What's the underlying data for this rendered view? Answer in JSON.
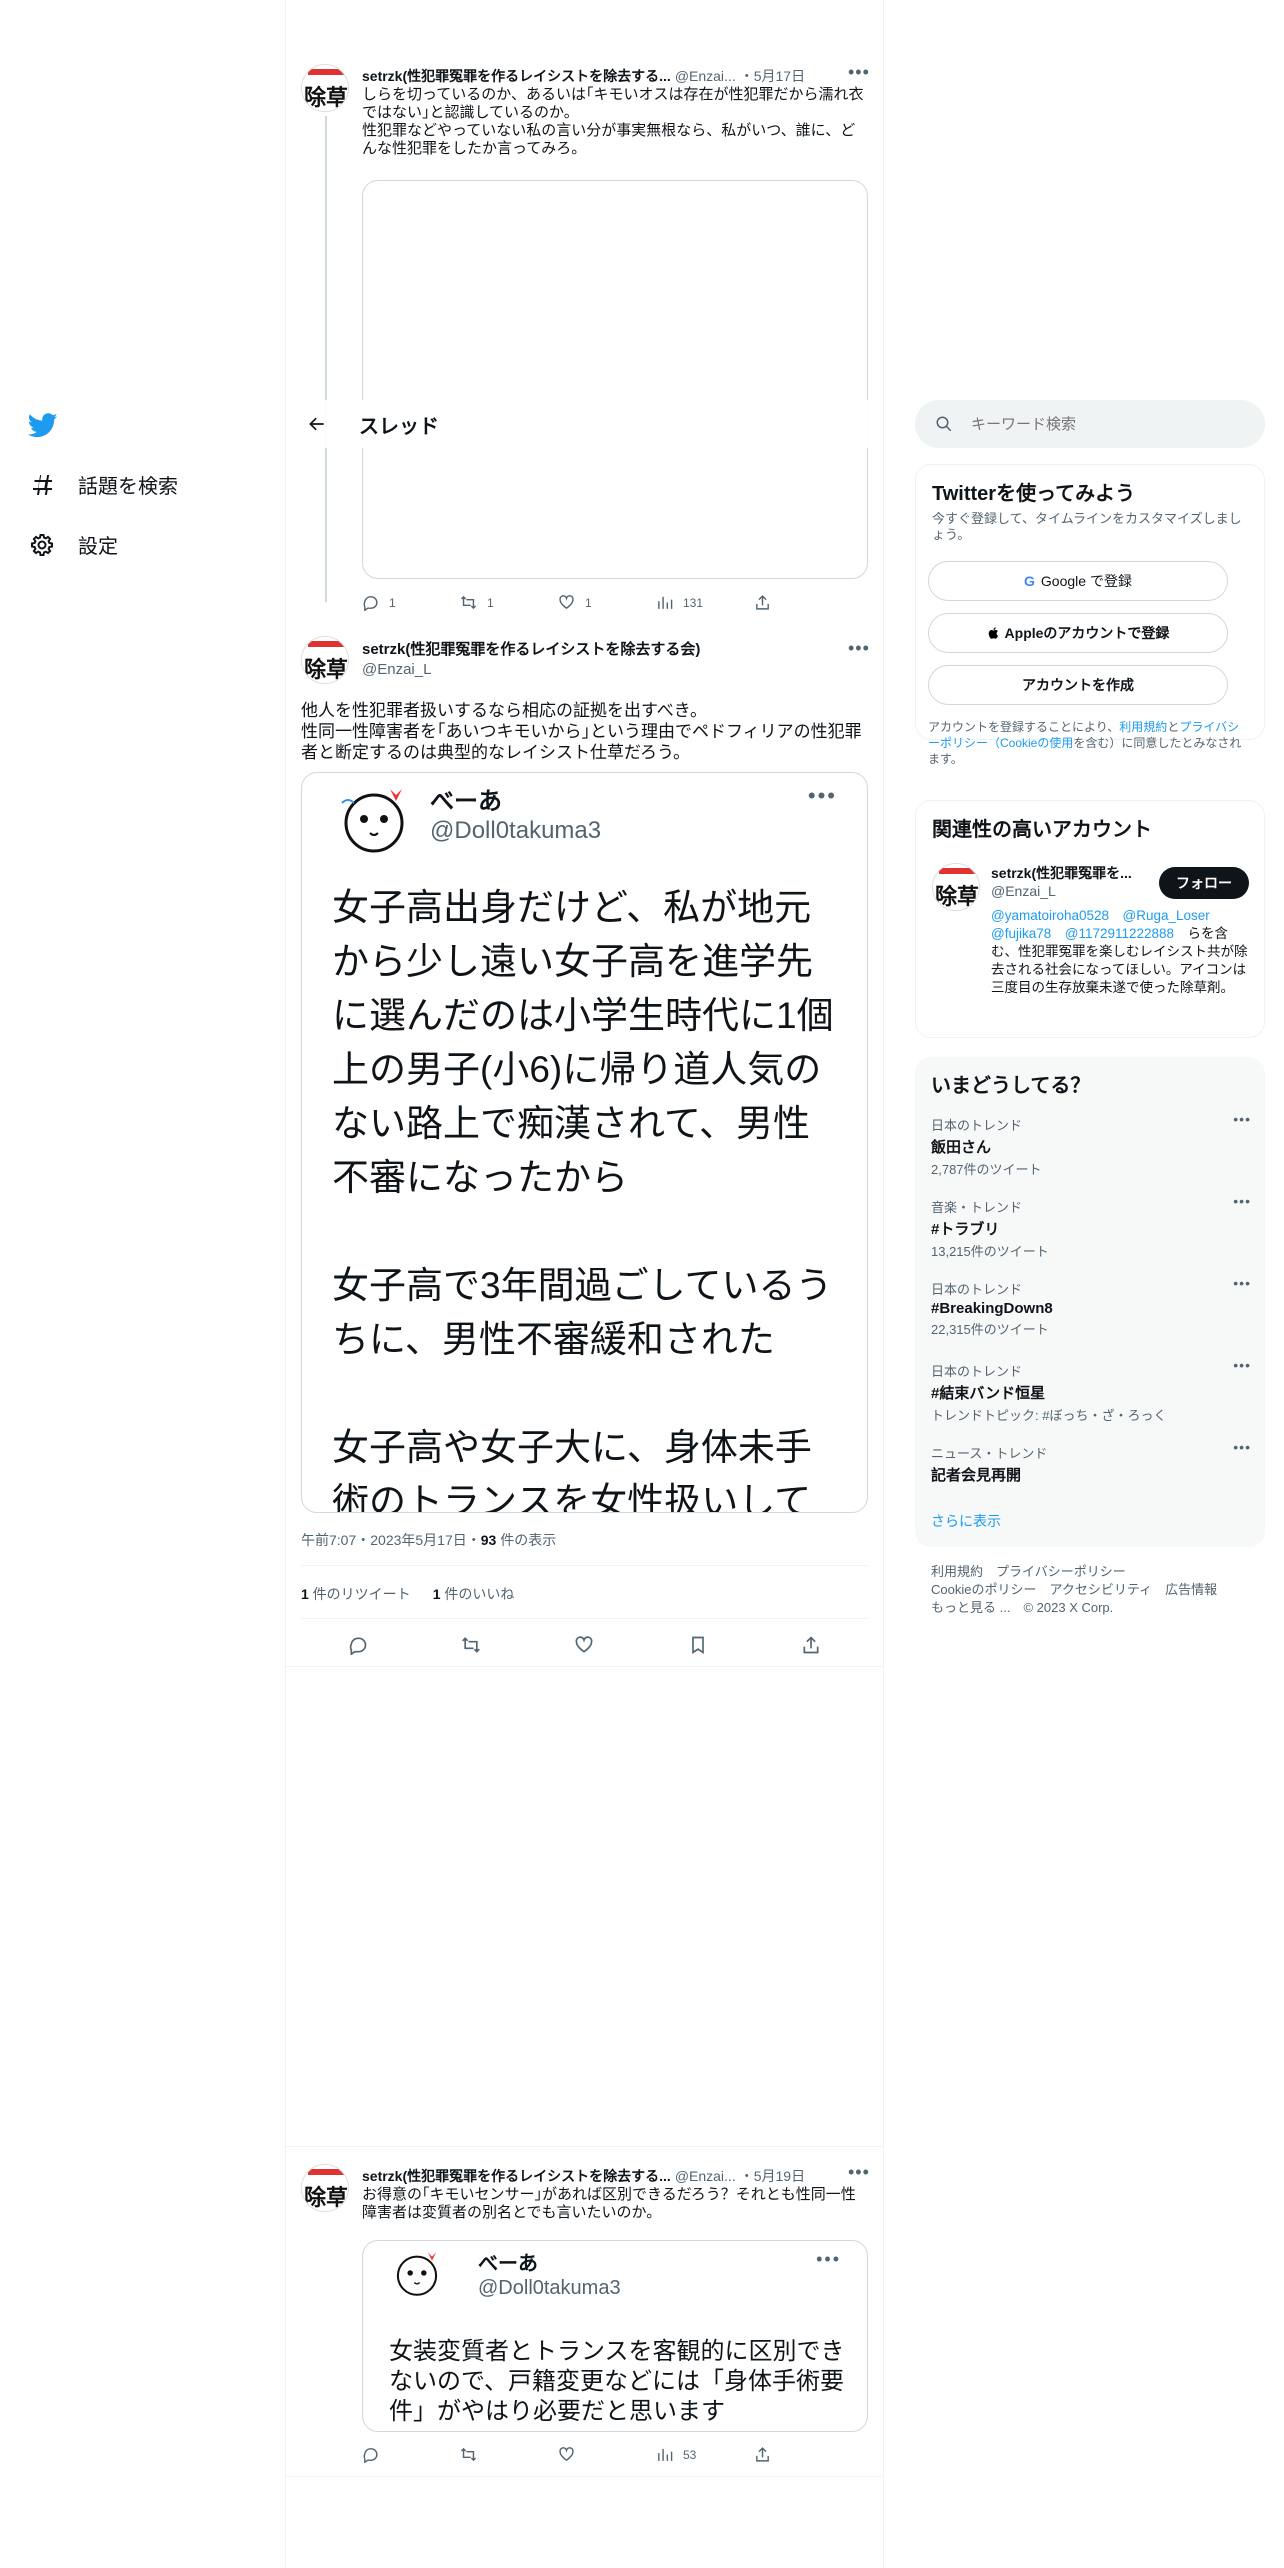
{
  "colors": {
    "brand": "#1d9bf0",
    "text": "#0f1419",
    "secondary": "#536471",
    "border": "#eff3f4"
  },
  "nav": {
    "logo": "twitter-bird-icon",
    "explore_label": "話題を検索",
    "settings_label": "設定"
  },
  "header": {
    "title": "スレッド"
  },
  "tweet1": {
    "name": "setrzk(性犯罪冤罪を作るレイシストを除去する...",
    "handle": "@Enzai...",
    "date": "・5月17日",
    "text": "しらを切っているのか、あるいは｢キモいオスは存在が性犯罪だから濡れ衣ではない｣と認識しているのか。\n性犯罪などやっていない私の言い分が事実無根なら、私がいつ、誰に、どんな性犯罪をしたか言ってみろ。",
    "replies": "1",
    "retweets": "1",
    "likes": "1",
    "views": "131"
  },
  "main_tweet": {
    "name": "setrzk(性犯罪冤罪を作るレイシストを除去する会)",
    "handle": "@Enzai_L",
    "text": "他人を性犯罪者扱いするなら相応の証拠を出すべき。\n性同一性障害者を｢あいつキモいから｣という理由でペドフィリアの性犯罪者と断定するのは典型的なレイシスト仕草だろう。",
    "quoted": {
      "name": "べーあ",
      "handle": "@Doll0takuma3",
      "text": "女子高出身だけど、私が地元から少し遠い女子高を進学先に選んだのは小学生時代に1個上の男子(小6)に帰り道人気のない路上で痴漢されて、男性不審になったから\n\n女子高で3年間過ごしているうちに、男性不審緩和された\n\n女子高や女子大に、身体未手術のトランスを女性扱いして受け入れることには反対"
    },
    "time": "午前7:07・2023年5月17日・",
    "views_count": "93",
    "views_label": " 件の表示",
    "retweet_count": "1",
    "retweet_label": " 件のリツイート",
    "like_count": "1",
    "like_label": " 件のいいね"
  },
  "tweet3": {
    "name": "setrzk(性犯罪冤罪を作るレイシストを除去する...",
    "handle": "@Enzai...",
    "date": "・5月19日",
    "text": "お得意の｢キモいセンサー｣があれば区別できるだろう？それとも性同一性障害者は変質者の別名とでも言いたいのか。",
    "quoted": {
      "name": "べーあ",
      "handle": "@Doll0takuma3",
      "text": "女装変質者とトランスを客観的に区別できないので、戸籍変更などには「身体手術要件」がやはり必要だと思います"
    },
    "views": "53"
  },
  "sidebar": {
    "search_placeholder": "キーワード検索",
    "signup": {
      "title": "Twitterを使ってみよう",
      "subtitle": "今すぐ登録して、タイムラインをカスタマイズしましょう。",
      "google": "Google で登録",
      "apple": "Appleのアカウントで登録",
      "create": "アカウントを作成",
      "terms_pre": "アカウントを登録することにより、",
      "terms_link1": "利用規約",
      "terms_and": "と",
      "terms_link2": "プライバシーポリシー（Cookieの使用",
      "terms_post": "を含む）に同意したとみなされます。"
    },
    "relevant": {
      "title": "関連性の高いアカウント",
      "name": "setrzk(性犯罪冤罪を...",
      "handle": "@Enzai_L",
      "follow": "フォロー",
      "bio_links": "@yamatoiroha0528　@Ruga_Loser　@fujika78　@1172911222888",
      "bio": "　らを含む、性犯罪冤罪を楽しむレイシスト共が除去される社会になってほしい。アイコンは三度目の生存放棄未遂で使った除草剤。"
    },
    "trends": {
      "title": "いまどうしてる？",
      "items": [
        {
          "meta": "日本のトレンド",
          "name": "飯田さん",
          "count": "2,787件のツイート"
        },
        {
          "meta": "音楽・トレンド",
          "name": "#トラブリ",
          "count": "13,215件のツイート"
        },
        {
          "meta": "日本のトレンド",
          "name": "#BreakingDown8",
          "count": "22,315件のツイート"
        },
        {
          "meta": "日本のトレンド",
          "name": "#結束バンド恒星",
          "count": "トレンドトピック: #ぼっち・ざ・ろっく"
        },
        {
          "meta": "ニュース・トレンド",
          "name": "記者会見再開",
          "count": ""
        }
      ],
      "show_more": "さらに表示"
    },
    "footer": {
      "terms": "利用規約",
      "privacy": "プライバシーポリシー",
      "cookie": "Cookieのポリシー",
      "accessibility": "アクセシビリティ",
      "ads": "広告情報",
      "more": "もっと見る ...",
      "copyright": "© 2023 X Corp."
    }
  }
}
